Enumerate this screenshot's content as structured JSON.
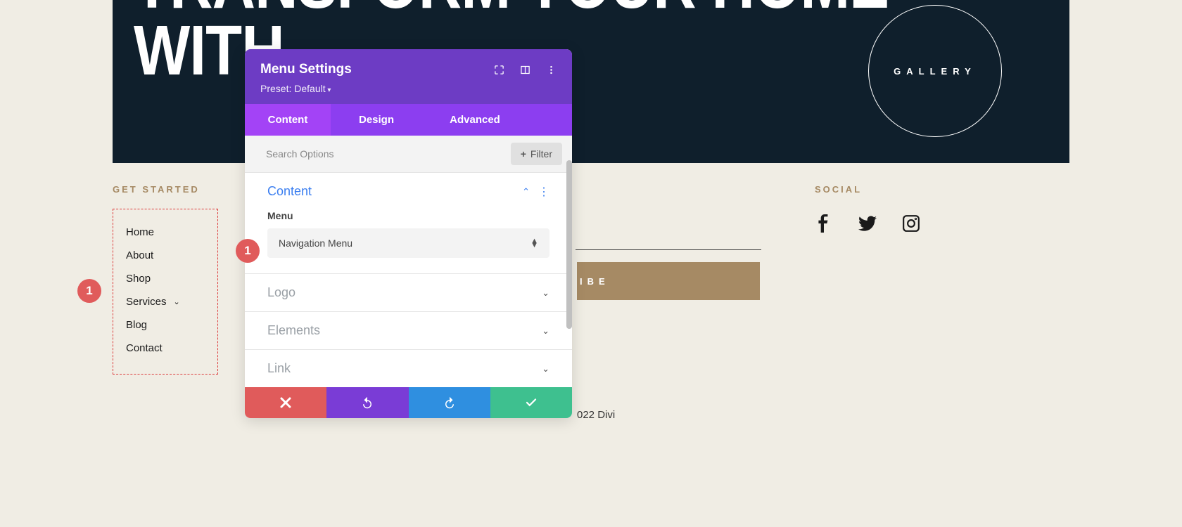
{
  "hero": {
    "title": "TRANSFORM YOUR HOME\nWITH",
    "gallery": "GALLERY"
  },
  "get_started": {
    "heading": "GET STARTED",
    "items": [
      "Home",
      "About",
      "Shop",
      "Services",
      "Blog",
      "Contact"
    ],
    "dropdown_index": 3
  },
  "social": {
    "heading": "SOCIAL",
    "icons": [
      "facebook",
      "twitter",
      "instagram"
    ]
  },
  "subscribe": {
    "button_fragment": "IBE"
  },
  "copy": "022 Divi",
  "badges": {
    "nav": "1",
    "field": "1"
  },
  "panel": {
    "title": "Menu Settings",
    "preset": "Preset: Default",
    "tabs": [
      "Content",
      "Design",
      "Advanced"
    ],
    "active_tab": 0,
    "search_placeholder": "Search Options",
    "filter_label": "Filter",
    "groups": [
      {
        "title": "Content",
        "open": true
      },
      {
        "title": "Logo",
        "open": false
      },
      {
        "title": "Elements",
        "open": false
      },
      {
        "title": "Link",
        "open": false
      }
    ],
    "content_group": {
      "field_label": "Menu",
      "select_value": "Navigation Menu"
    }
  }
}
